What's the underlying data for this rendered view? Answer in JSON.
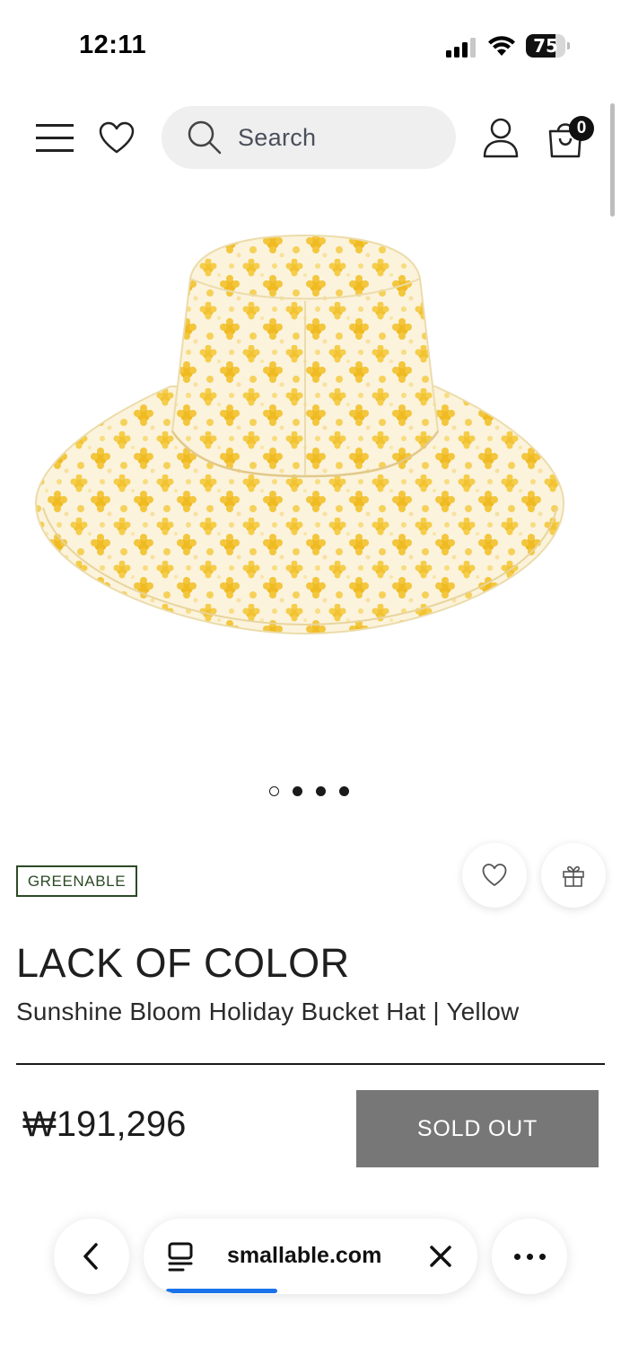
{
  "status_bar": {
    "time": "12:11",
    "battery_percent": "75",
    "battery_level": 0.75,
    "signal_bars": 3
  },
  "header": {
    "search_placeholder": "Search",
    "cart_count": "0"
  },
  "gallery": {
    "image_count": 4,
    "active_index": 0
  },
  "product": {
    "badge": "GREENABLE",
    "brand": "LACK OF COLOR",
    "name": "Sunshine Bloom Holiday Bucket Hat | Yellow",
    "price": "₩191,296",
    "cta_label": "SOLD OUT"
  },
  "browser": {
    "domain": "smallable.com",
    "load_progress": 0.4
  },
  "colors": {
    "badge_green": "#2c4a26",
    "sold_out_bg": "#777777",
    "progress_blue": "#1a73e8",
    "hat_yellow": "#f2c230"
  }
}
